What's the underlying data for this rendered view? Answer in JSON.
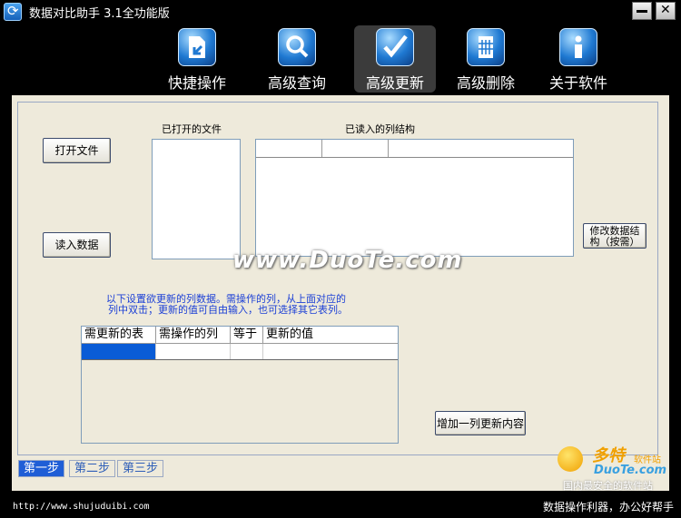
{
  "window": {
    "title": "数据对比助手 3.1全功能版"
  },
  "nav": {
    "items": [
      {
        "label": "快捷操作",
        "icon": "quick-action-icon"
      },
      {
        "label": "高级查询",
        "icon": "magnifier-icon"
      },
      {
        "label": "高级更新",
        "icon": "checkmark-icon"
      },
      {
        "label": "高级删除",
        "icon": "trash-icon"
      },
      {
        "label": "关于软件",
        "icon": "info-icon"
      }
    ],
    "active": "高级更新"
  },
  "step1": {
    "open_file_label": "打开文件",
    "read_data_label": "读入数据",
    "opened_files_label": "已打开的文件",
    "read_columns_label": "已读入的列结构",
    "modify_label_line1": "修改数据结",
    "modify_label_line2": "构（按需）",
    "instruction_line1": "以下设置欲更新的列数据。需操作的列，从上面对应的",
    "instruction_line2": "列中双击；更新的值可自由输入，也可选择其它表列。",
    "grid_columns": [
      "需更新的表",
      "需操作的列",
      "等于",
      "更新的值"
    ],
    "add_label": "增加一列更新内容"
  },
  "tabs": [
    "第一步",
    "第二步",
    "第三步"
  ],
  "watermark": {
    "main": "www.DuoTe.com",
    "logo_cn": "多特",
    "logo_soft": "软件站",
    "logo_domain": "DuoTe.com",
    "tagline": "国内最安全的软件站"
  },
  "footer": {
    "url": "http://www.shujuduibi.com",
    "slogan": "数据操作利器，办公好帮手"
  },
  "colors": {
    "accent": "#1f5ed6",
    "instruction": "#1b3fd6",
    "panel": "#eeeadb"
  }
}
